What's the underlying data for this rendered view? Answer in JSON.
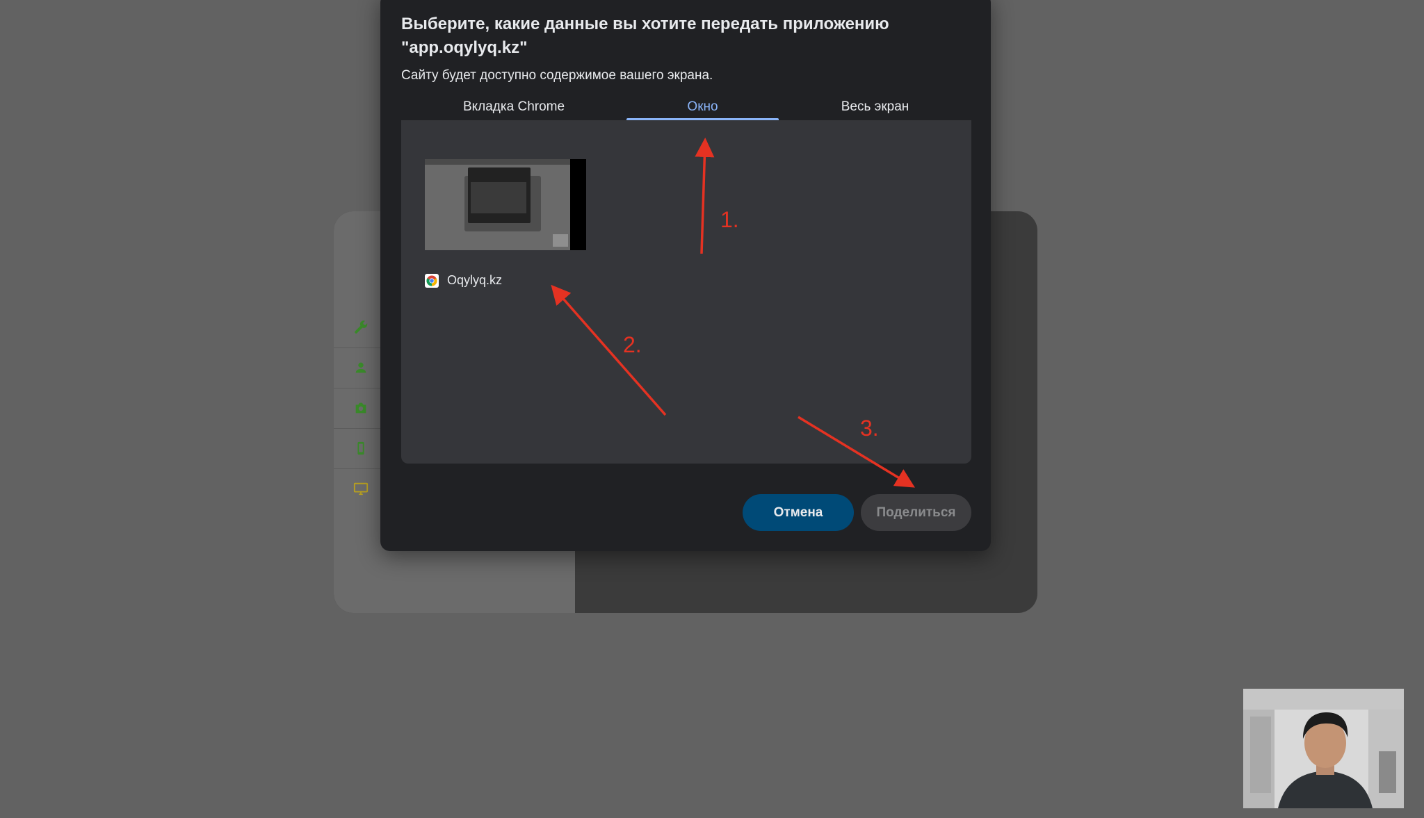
{
  "dialog": {
    "title": "Выберите, какие данные вы хотите передать приложению \"app.oqylyq.kz\"",
    "subtitle": "Сайту будет доступно содержимое вашего экрана.",
    "tabs": [
      {
        "label": "Вкладка Chrome",
        "active": false
      },
      {
        "label": "Окно",
        "active": true
      },
      {
        "label": "Весь экран",
        "active": false
      }
    ],
    "window_item": {
      "label": "Oqylyq.kz",
      "icon": "chrome-icon"
    },
    "buttons": {
      "cancel_label": "Отмена",
      "share_label": "Поделиться"
    }
  },
  "annotations": {
    "step1": "1.",
    "step2": "2.",
    "step3": "3.",
    "color": "#e53222"
  },
  "background_sidebar_icons": [
    "wrench-icon",
    "person-icon",
    "camera-icon",
    "phone-icon",
    "monitor-icon"
  ],
  "colors": {
    "accent": "#8ab4f8",
    "cancel_bg": "#004a77",
    "dialog_bg": "#202124",
    "panel_bg": "#35363a",
    "sidebar_icon_green": "#3a8a2a",
    "sidebar_icon_yellow": "#b8a020"
  }
}
